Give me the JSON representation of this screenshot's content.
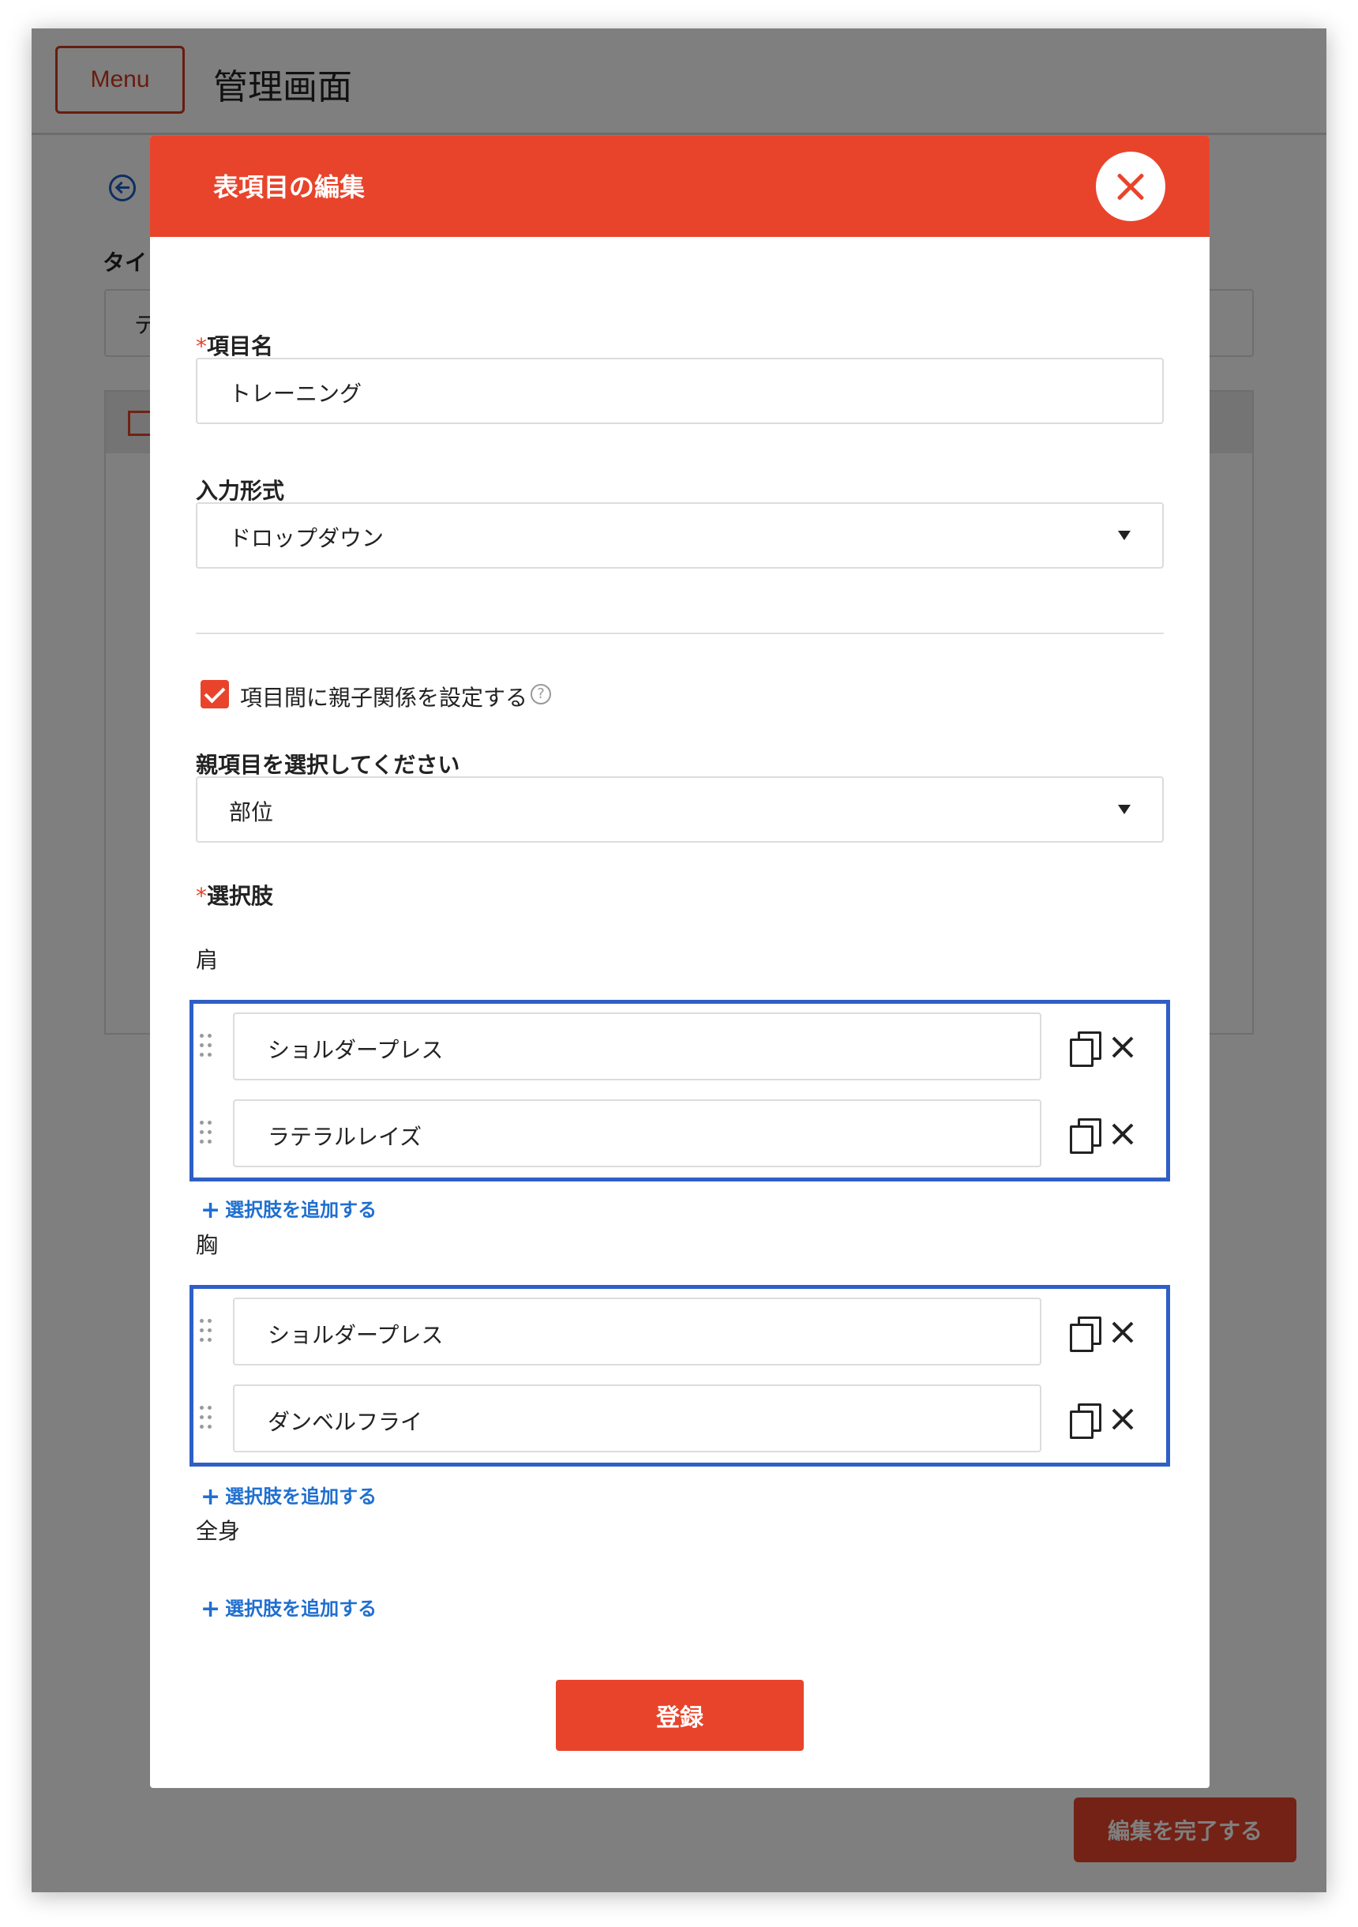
{
  "app": {
    "menu_label": "Menu",
    "title": "管理画面"
  },
  "background": {
    "field_label_partial": "タイ",
    "field_value_partial": "テ",
    "complete_button": "編集を完了する"
  },
  "modal": {
    "title": "表項目の編集",
    "required_mark": "*",
    "item_name": {
      "label": "項目名",
      "value": "トレーニング"
    },
    "input_format": {
      "label": "入力形式",
      "value": "ドロップダウン"
    },
    "parent_child": {
      "label": "項目間に親子関係を設定する",
      "checked": true,
      "help": "?"
    },
    "parent_select": {
      "label": "親項目を選択してください",
      "value": "部位"
    },
    "options_label": "選択肢",
    "add_option_label": "選択肢を追加する",
    "groups": [
      {
        "name": "肩",
        "options": [
          "ショルダープレス",
          "ラテラルレイズ"
        ]
      },
      {
        "name": "胸",
        "options": [
          "ショルダープレス",
          "ダンベルフライ"
        ]
      },
      {
        "name": "全身",
        "options": []
      }
    ],
    "submit_label": "登録"
  },
  "colors": {
    "accent": "#e8442b",
    "link": "#1f6fd0",
    "highlight_border": "#2f5fc6"
  }
}
